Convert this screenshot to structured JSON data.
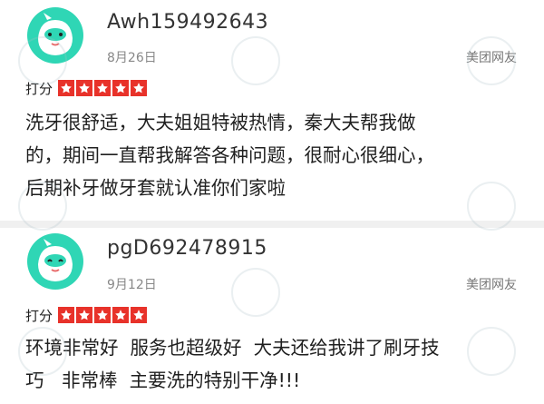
{
  "reviews": [
    {
      "username": "Awh159492643",
      "date": "8月26日",
      "source": "美团网友",
      "rating_label": "打分",
      "stars": 5,
      "lines": [
        "洗牙很舒适，大夫姐姐特被热情，秦大夫帮我做",
        "的，期间一直帮我解答各种问题，很耐心很细心，",
        "后期补牙做牙套就认准你们家啦"
      ]
    },
    {
      "username": "pgD692478915",
      "date": "9月12日",
      "source": "美团网友",
      "rating_label": "打分",
      "stars": 5,
      "lines": [
        "环境非常好  服务也超级好  大夫还给我讲了刷牙技",
        "巧   非常棒  主要洗的特别干净!!!"
      ]
    }
  ],
  "colors": {
    "star_bg": "#e8322a",
    "avatar_green": "#2fd6b5",
    "divider": "#f0f0f0"
  }
}
